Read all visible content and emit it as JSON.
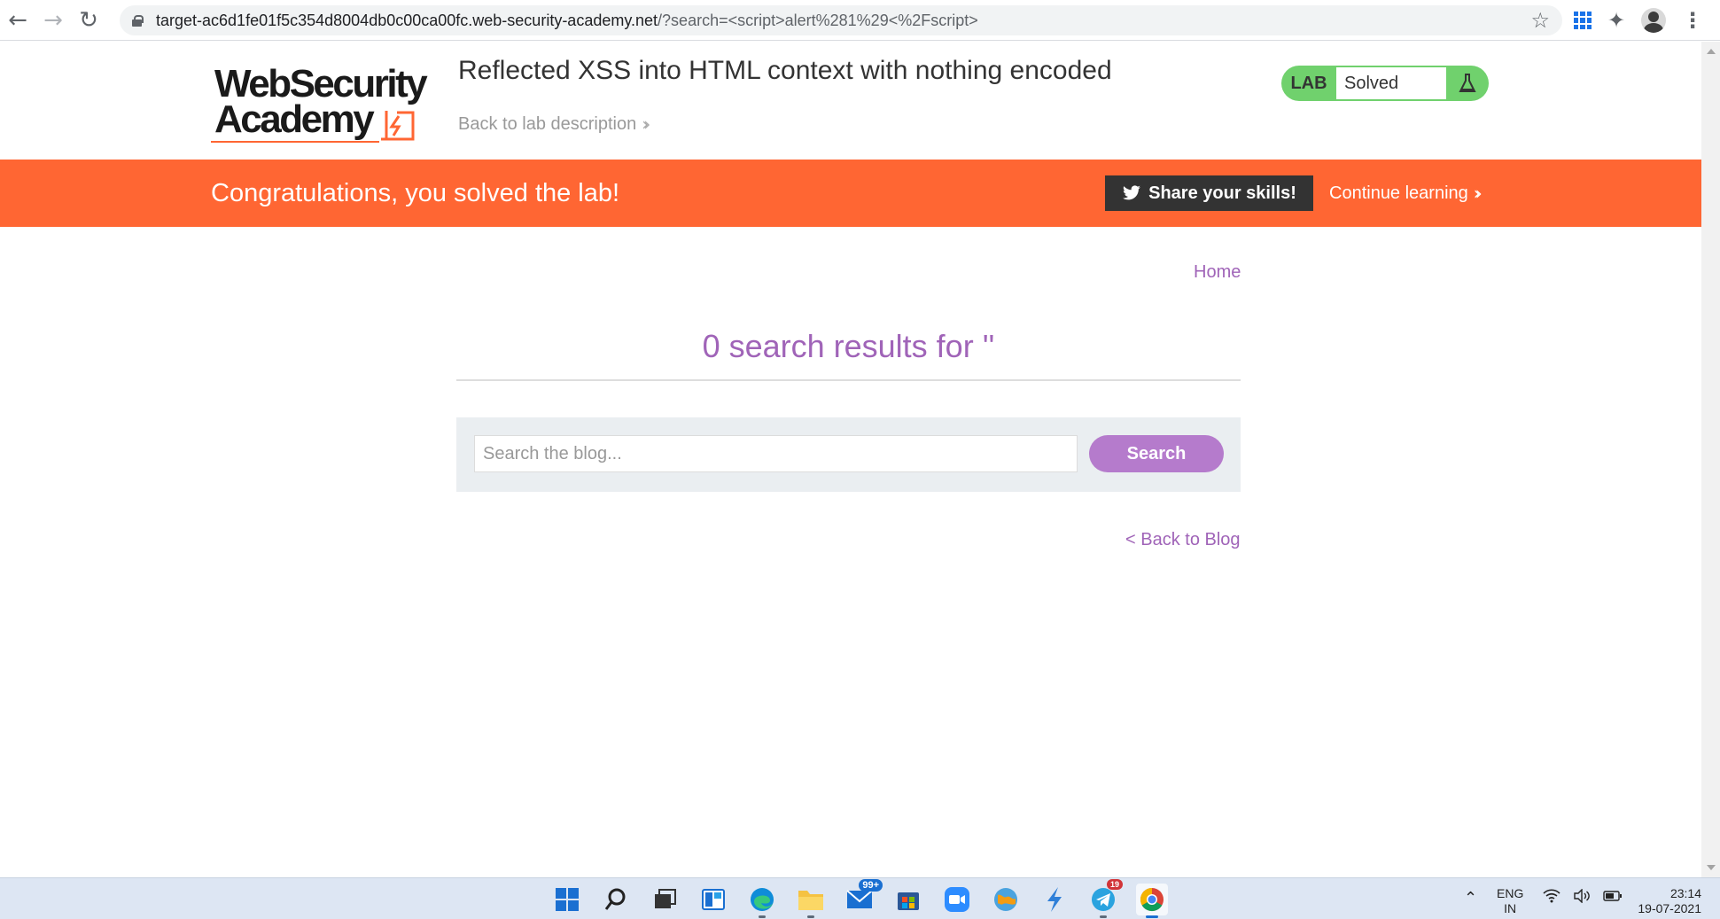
{
  "browser": {
    "url_host": "target-ac6d1fe01f5c354d8004db0c00ca00fc.web-security-academy.net",
    "url_path": "/?search=<script>alert%281%29<%2Fscript>"
  },
  "header": {
    "logo_line1": "WebSecurity",
    "logo_line2": "Academy",
    "lab_title": "Reflected XSS into HTML context with nothing encoded",
    "back_link": "Back to lab description",
    "status_tag": "LAB",
    "status_text": "Solved"
  },
  "banner": {
    "message": "Congratulations, you solved the lab!",
    "share_label": "Share your skills!",
    "continue_label": "Continue learning"
  },
  "blog": {
    "home_link": "Home",
    "results_heading": "0 search results for ''",
    "search_placeholder": "Search the blog...",
    "search_button": "Search",
    "back_link": "< Back to Blog"
  },
  "taskbar": {
    "mail_badge": "99+",
    "telegram_badge": "19",
    "lang_line1": "ENG",
    "lang_line2": "IN",
    "time": "23:14",
    "date": "19-07-2021"
  },
  "colors": {
    "accent_orange": "#ff6633",
    "link_purple": "#a064b8",
    "button_purple": "#b57bcc",
    "status_green": "#70d16d"
  }
}
